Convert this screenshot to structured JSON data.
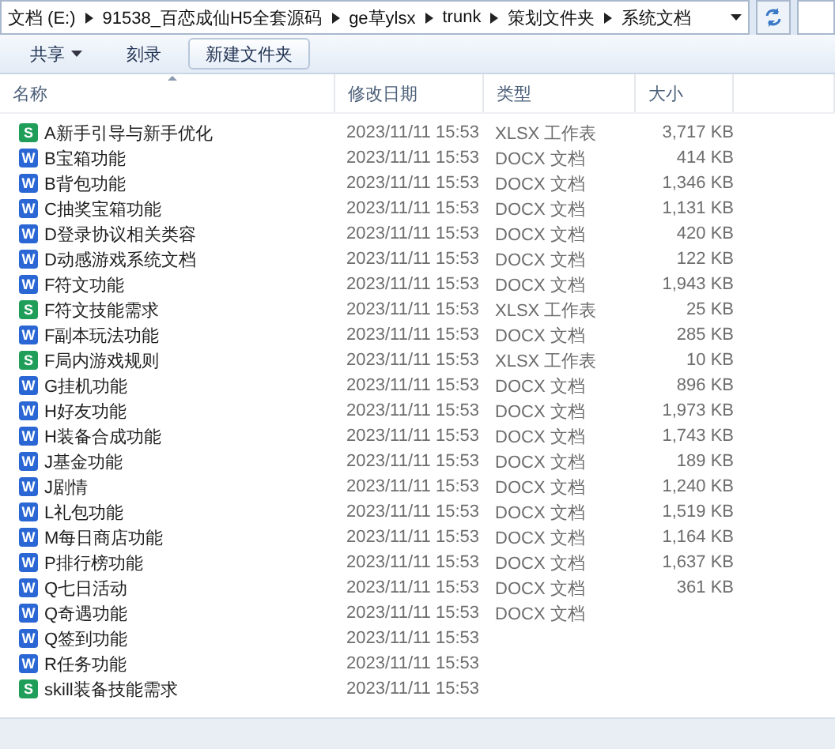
{
  "address_bar": {
    "path": [
      "文档 (E:)",
      "91538_百恋成仙H5全套源码",
      "ge草ylsx",
      "trunk",
      "策划文件夹",
      "系统文档"
    ]
  },
  "toolbar": {
    "buttons": [
      {
        "label": "共享",
        "menu": true,
        "hovered": false
      },
      {
        "label": "刻录",
        "menu": false,
        "hovered": false
      },
      {
        "label": "新建文件夹",
        "menu": false,
        "hovered": true
      }
    ]
  },
  "columns": [
    {
      "label": "名称",
      "sorted": true
    },
    {
      "label": "修改日期",
      "sorted": false
    },
    {
      "label": "类型",
      "sorted": false
    },
    {
      "label": "大小",
      "sorted": false
    }
  ],
  "rows": [
    {
      "kind": "xlsx",
      "icon": "S",
      "name": "A新手引导与新手优化",
      "date": "2023/11/11 15:53",
      "type": "XLSX 工作表",
      "size": "3,717 KB"
    },
    {
      "kind": "docx",
      "icon": "W",
      "name": "B宝箱功能",
      "date": "2023/11/11 15:53",
      "type": "DOCX 文档",
      "size": "414 KB"
    },
    {
      "kind": "docx",
      "icon": "W",
      "name": "B背包功能",
      "date": "2023/11/11 15:53",
      "type": "DOCX 文档",
      "size": "1,346 KB"
    },
    {
      "kind": "docx",
      "icon": "W",
      "name": "C抽奖宝箱功能",
      "date": "2023/11/11 15:53",
      "type": "DOCX 文档",
      "size": "1,131 KB"
    },
    {
      "kind": "docx",
      "icon": "W",
      "name": "D登录协议相关类容",
      "date": "2023/11/11 15:53",
      "type": "DOCX 文档",
      "size": "420 KB"
    },
    {
      "kind": "docx",
      "icon": "W",
      "name": "D动感游戏系统文档",
      "date": "2023/11/11 15:53",
      "type": "DOCX 文档",
      "size": "122 KB"
    },
    {
      "kind": "docx",
      "icon": "W",
      "name": "F符文功能",
      "date": "2023/11/11 15:53",
      "type": "DOCX 文档",
      "size": "1,943 KB"
    },
    {
      "kind": "xlsx",
      "icon": "S",
      "name": "F符文技能需求",
      "date": "2023/11/11 15:53",
      "type": "XLSX 工作表",
      "size": "25 KB"
    },
    {
      "kind": "docx",
      "icon": "W",
      "name": "F副本玩法功能",
      "date": "2023/11/11 15:53",
      "type": "DOCX 文档",
      "size": "285 KB"
    },
    {
      "kind": "xlsx",
      "icon": "S",
      "name": "F局内游戏规则",
      "date": "2023/11/11 15:53",
      "type": "XLSX 工作表",
      "size": "10 KB"
    },
    {
      "kind": "docx",
      "icon": "W",
      "name": "G挂机功能",
      "date": "2023/11/11 15:53",
      "type": "DOCX 文档",
      "size": "896 KB"
    },
    {
      "kind": "docx",
      "icon": "W",
      "name": "H好友功能",
      "date": "2023/11/11 15:53",
      "type": "DOCX 文档",
      "size": "1,973 KB"
    },
    {
      "kind": "docx",
      "icon": "W",
      "name": "H装备合成功能",
      "date": "2023/11/11 15:53",
      "type": "DOCX 文档",
      "size": "1,743 KB"
    },
    {
      "kind": "docx",
      "icon": "W",
      "name": "J基金功能",
      "date": "2023/11/11 15:53",
      "type": "DOCX 文档",
      "size": "189 KB"
    },
    {
      "kind": "docx",
      "icon": "W",
      "name": "J剧情",
      "date": "2023/11/11 15:53",
      "type": "DOCX 文档",
      "size": "1,240 KB"
    },
    {
      "kind": "docx",
      "icon": "W",
      "name": "L礼包功能",
      "date": "2023/11/11 15:53",
      "type": "DOCX 文档",
      "size": "1,519 KB"
    },
    {
      "kind": "docx",
      "icon": "W",
      "name": "M每日商店功能",
      "date": "2023/11/11 15:53",
      "type": "DOCX 文档",
      "size": "1,164 KB"
    },
    {
      "kind": "docx",
      "icon": "W",
      "name": "P排行榜功能",
      "date": "2023/11/11 15:53",
      "type": "DOCX 文档",
      "size": "1,637 KB"
    },
    {
      "kind": "docx",
      "icon": "W",
      "name": "Q七日活动",
      "date": "2023/11/11 15:53",
      "type": "DOCX 文档",
      "size": "361 KB"
    },
    {
      "kind": "docx",
      "icon": "W",
      "name": "Q奇遇功能",
      "date": "2023/11/11 15:53",
      "type": "DOCX 文档"
    },
    {
      "kind": "docx",
      "icon": "W",
      "name": "Q签到功能",
      "date": "2023/11/11 15:53"
    },
    {
      "kind": "docx",
      "icon": "W",
      "name": "R任务功能",
      "date": "2023/11/11 15:53"
    },
    {
      "kind": "xlsx",
      "icon": "S",
      "name": "skill装备技能需求",
      "date": "2023/11/11 15:53"
    }
  ]
}
